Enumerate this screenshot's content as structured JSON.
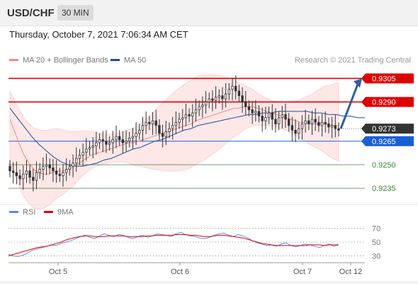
{
  "header": {
    "symbol": "USD/CHF",
    "timeframe": "30 MIN"
  },
  "timestamp": "Thursday, October 7, 2021 7:06:34 AM CET",
  "legend": {
    "ma20_label": "MA 20 + Bollinger Bands",
    "ma50_label": "MA 50",
    "credit": "Research © 2021 Trading Central"
  },
  "rsi_legend": {
    "rsi_label": "RSI",
    "ma_label": "9MA"
  },
  "colors": {
    "ma20": "#f28b82",
    "bollinger_fill": "#fde3e3",
    "ma50": "#1f4e9c",
    "resistance": "#e00000",
    "pivot": "#1a5fd6",
    "support": "#3a8a3a",
    "current": "#333333",
    "rsi": "#5b8def",
    "rsi_ma": "#e00000",
    "candle_up": "#333333",
    "candle_down": "#333333",
    "arrow": "#2f5f9e"
  },
  "chart_data": {
    "type": "candlestick",
    "x_tick_labels": [
      "Oct 5",
      "Oct 6",
      "Oct 7",
      "Oct 12"
    ],
    "ylim": [
      0.9226,
      0.9312
    ],
    "levels": [
      {
        "value": 0.9305,
        "label": "0.9305",
        "kind": "resistance"
      },
      {
        "value": 0.929,
        "label": "0.9290",
        "kind": "resistance"
      },
      {
        "value": 0.9273,
        "label": "0.9273",
        "kind": "current"
      },
      {
        "value": 0.9265,
        "label": "0.9265",
        "kind": "pivot"
      },
      {
        "value": 0.925,
        "label": "0.9250",
        "kind": "support"
      },
      {
        "value": 0.9235,
        "label": "0.9235",
        "kind": "support"
      }
    ],
    "close": [
      0.9246,
      0.9245,
      0.9243,
      0.9241,
      0.9244,
      0.9246,
      0.9242,
      0.924,
      0.9245,
      0.9247,
      0.9249,
      0.925,
      0.9248,
      0.9246,
      0.9244,
      0.9243,
      0.9245,
      0.9247,
      0.9249,
      0.9251,
      0.9254,
      0.9256,
      0.9258,
      0.926,
      0.9261,
      0.9262,
      0.9264,
      0.9266,
      0.9265,
      0.9263,
      0.9264,
      0.9266,
      0.9268,
      0.9266,
      0.9264,
      0.9265,
      0.9267,
      0.9268,
      0.927,
      0.9272,
      0.9275,
      0.9277,
      0.9276,
      0.9278,
      0.9275,
      0.927,
      0.9268,
      0.9271,
      0.9273,
      0.9275,
      0.9277,
      0.9279,
      0.928,
      0.9282,
      0.9281,
      0.9283,
      0.9285,
      0.9287,
      0.9288,
      0.929,
      0.9292,
      0.9291,
      0.9293,
      0.9294,
      0.9292,
      0.9295,
      0.9298,
      0.93,
      0.9297,
      0.9294,
      0.929,
      0.9287,
      0.9285,
      0.9283,
      0.9284,
      0.9281,
      0.9278,
      0.928,
      0.9283,
      0.9279,
      0.9276,
      0.928,
      0.9282,
      0.9279,
      0.9275,
      0.9272,
      0.927,
      0.9273,
      0.9276,
      0.9278,
      0.9276,
      0.9279,
      0.9277,
      0.9275,
      0.9277,
      0.9276,
      0.9274,
      0.9275,
      0.9273,
      0.9272
    ],
    "ma20": [
      0.9279,
      0.9271,
      0.9263,
      0.9256,
      0.9251,
      0.9247,
      0.9245,
      0.9244,
      0.9244,
      0.9245,
      0.9246,
      0.9246,
      0.9247,
      0.9248,
      0.925,
      0.9252,
      0.9254,
      0.9256,
      0.9257,
      0.9258,
      0.9259,
      0.926,
      0.9261,
      0.9262,
      0.9263,
      0.9264,
      0.9264,
      0.9265,
      0.9266,
      0.9267,
      0.9268,
      0.9269,
      0.927,
      0.9271,
      0.9272,
      0.9273,
      0.9274,
      0.9275,
      0.9276,
      0.9278,
      0.9279,
      0.928,
      0.9281,
      0.9282,
      0.9283,
      0.9284,
      0.9285,
      0.9286,
      0.9286,
      0.9287,
      0.9287,
      0.9287,
      0.9286,
      0.9285,
      0.9284,
      0.9283,
      0.9282,
      0.9281,
      0.928,
      0.9279,
      0.9278,
      0.9277,
      0.9277,
      0.9276,
      0.9276,
      0.9276,
      0.9276,
      0.9275,
      0.9275,
      0.9275
    ],
    "ma50": [
      0.9286,
      0.928,
      0.9274,
      0.9268,
      0.9263,
      0.9259,
      0.9255,
      0.9252,
      0.925,
      0.9249,
      0.9249,
      0.925,
      0.9251,
      0.9253,
      0.9254,
      0.9256,
      0.9258,
      0.926,
      0.9261,
      0.9263,
      0.9265,
      0.9266,
      0.9268,
      0.927,
      0.9272,
      0.9273,
      0.9275,
      0.9276,
      0.9277,
      0.9278,
      0.9279,
      0.928,
      0.9281,
      0.9282,
      0.9282,
      0.9283,
      0.9283,
      0.9284,
      0.9284,
      0.9284,
      0.9284,
      0.9284,
      0.9283,
      0.9283,
      0.9282,
      0.9282,
      0.9281,
      0.9281,
      0.928,
      0.928
    ],
    "rsi_ticks": [
      70,
      50,
      30
    ],
    "rsi_ylim": [
      20,
      80
    ],
    "rsi": [
      32,
      30,
      29,
      31,
      34,
      38,
      40,
      42,
      44,
      46,
      45,
      48,
      50,
      52,
      55,
      58,
      60,
      57,
      55,
      59,
      62,
      60,
      58,
      61,
      60,
      57,
      55,
      58,
      60,
      57,
      59,
      62,
      61,
      60,
      58,
      62,
      64,
      61,
      59,
      58,
      56,
      55,
      57,
      60,
      62,
      63,
      60,
      58,
      61,
      59,
      56,
      52,
      49,
      47,
      45,
      46,
      44,
      47,
      49,
      45,
      43,
      45,
      47,
      46,
      44,
      42,
      45,
      47,
      44,
      46
    ],
    "rsi_ma": [
      30,
      32,
      34,
      36,
      38,
      40,
      42,
      43,
      44,
      46,
      48,
      50,
      53,
      55,
      57,
      58,
      59,
      59,
      58,
      58,
      58,
      59,
      59,
      59,
      59,
      58,
      58,
      58,
      58,
      59,
      59,
      60,
      60,
      60,
      60,
      61,
      61,
      61,
      60,
      60,
      59,
      58,
      58,
      59,
      60,
      60,
      59,
      58,
      57,
      56,
      54,
      52,
      50,
      48,
      47,
      46,
      45,
      45,
      45,
      45,
      45,
      45,
      45,
      46,
      46,
      46,
      45,
      46,
      46,
      46
    ],
    "forecast_arrow": {
      "from": 0.9273,
      "to": 0.9305
    }
  }
}
